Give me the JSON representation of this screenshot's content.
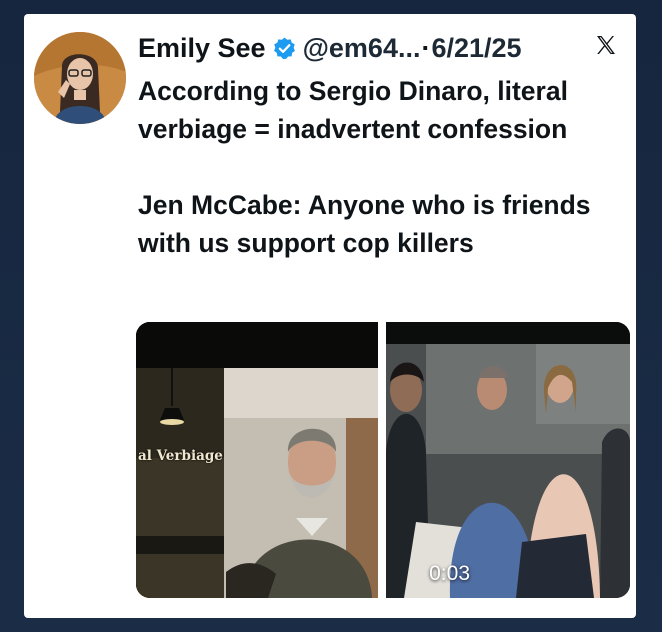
{
  "tweet": {
    "author_name": "Emily See",
    "handle": "@em64...",
    "separator": "·",
    "date": "6/21/25",
    "text_lines": [
      "According to Sergio Dinaro, literal verbiage = inadvertent confession",
      "Jen McCabe: Anyone who is friends with us support cop killers"
    ]
  },
  "media": {
    "left_caption": "al Verbiage",
    "duration": "0:03"
  },
  "icons": {
    "verified": "verified-badge-icon",
    "x_logo": "x-logo-icon"
  },
  "colors": {
    "verified_blue": "#1d9bf0",
    "text": "#0f1419",
    "background": "#16263e"
  }
}
